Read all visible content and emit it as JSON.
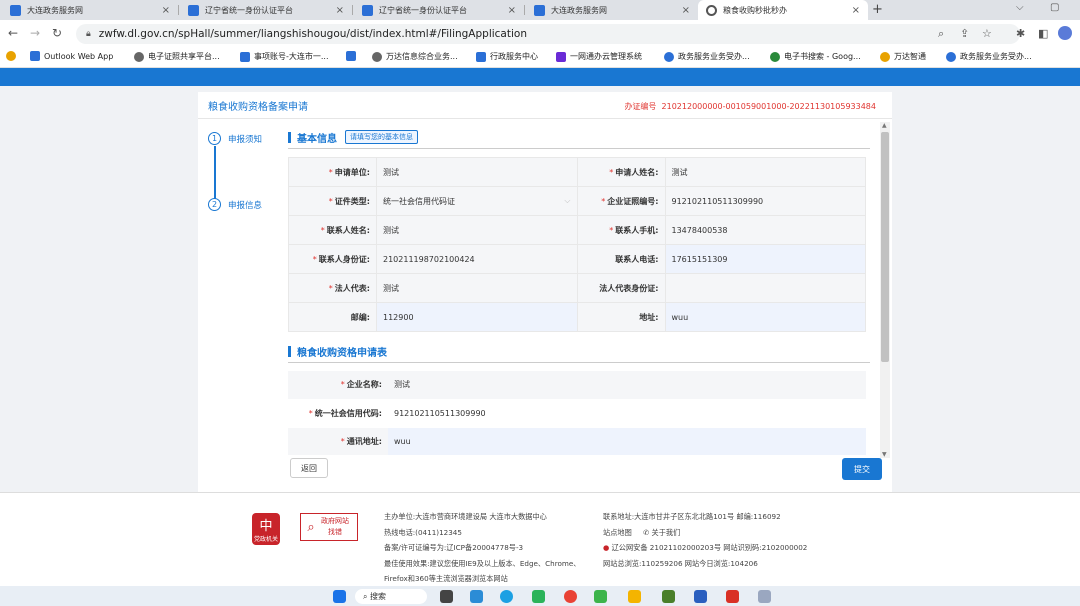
{
  "browser": {
    "tabs": [
      {
        "title": "大连政务服务网",
        "color": "#2b6fd6",
        "active": false
      },
      {
        "title": "辽宁省统一身份认证平台",
        "color": "#2b6fd6",
        "active": false
      },
      {
        "title": "辽宁省统一身份认证平台",
        "color": "#2b6fd6",
        "active": false
      },
      {
        "title": "大连政务服务网",
        "color": "#2b6fd6",
        "active": false
      },
      {
        "title": "粮食收购秒批秒办",
        "color": "#555555",
        "active": true
      }
    ],
    "close_glyph": "×",
    "new_tab_glyph": "+",
    "url": "zwfw.dl.gov.cn/spHall/summer/liangshishougou/dist/index.html#/FilingApplication",
    "bookmarks": [
      "Outlook Web App",
      "电子证照共享平台...",
      "事项账号-大连市一...",
      "万达信息综合业务...",
      "行政服务中心",
      "一网通办云管理系统",
      "政务服务业务受办...",
      "电子书搜索 - Goog...",
      "万达智通",
      "政务服务业务受办..."
    ]
  },
  "page": {
    "title": "粮食收购资格备案申请",
    "code_label": "办证编号",
    "code_value": "210212000000-001059001000-20221130105933484",
    "steps": [
      {
        "num": "1",
        "label": "申报须知"
      },
      {
        "num": "2",
        "label": "申报信息"
      }
    ],
    "section1": {
      "title": "基本信息",
      "badge": "请填写您的基本信息"
    },
    "section2": {
      "title": "粮食收购资格申请表"
    },
    "basic": {
      "unit_label": "申请单位:",
      "unit_value": "测试",
      "applicant_label": "申请人姓名:",
      "applicant_value": "测试",
      "idtype_label": "证件类型:",
      "idtype_value": "统一社会信用代码证",
      "license_label": "企业证照编号:",
      "license_value": "912102110511309990",
      "contact_label": "联系人姓名:",
      "contact_value": "测试",
      "mobile_label": "联系人手机:",
      "mobile_value": "13478400538",
      "idcard_label": "联系人身份证:",
      "idcard_value": "210211198702100424",
      "phone_label": "联系人电话:",
      "phone_value": "17615151309",
      "legal_label": "法人代表:",
      "legal_value": "测试",
      "legal_id_label": "法人代表身份证:",
      "legal_id_value": "",
      "zip_label": "邮编:",
      "zip_value": "112900",
      "addr_label": "地址:",
      "addr_value": "wuu"
    },
    "grain": {
      "company_label": "企业名称:",
      "company_value": "测试",
      "credit_label": "统一社会信用代码:",
      "credit_value": "912102110511309990",
      "mail_label": "通讯地址:",
      "mail_value": "wuu"
    },
    "back_label": "返回",
    "submit_label": "提交"
  },
  "footer": {
    "logo1_text": "党政机关",
    "logo2_line1": "政府网站",
    "logo2_line2": "找错",
    "left_lines": [
      "主办单位:大连市营商环境建设局 大连市大数据中心",
      "热线电话:(0411)12345",
      "备案/许可证编号为:辽ICP备20004778号-3",
      "最佳使用效果:建议您使用IE9及以上版本、Edge、Chrome、",
      "Firefox和360等主流浏览器浏览本网站"
    ],
    "right_lines": [
      "联系地址:大连市甘井子区东北北路101号 邮编:116092",
      "站点地图",
      "辽公网安备 21021102000203号 网站识别码:2102000002",
      "网站总浏览:110259206 网站今日浏览:104206"
    ],
    "about": "关于我们"
  },
  "taskbar": {
    "search_label": "搜索"
  }
}
